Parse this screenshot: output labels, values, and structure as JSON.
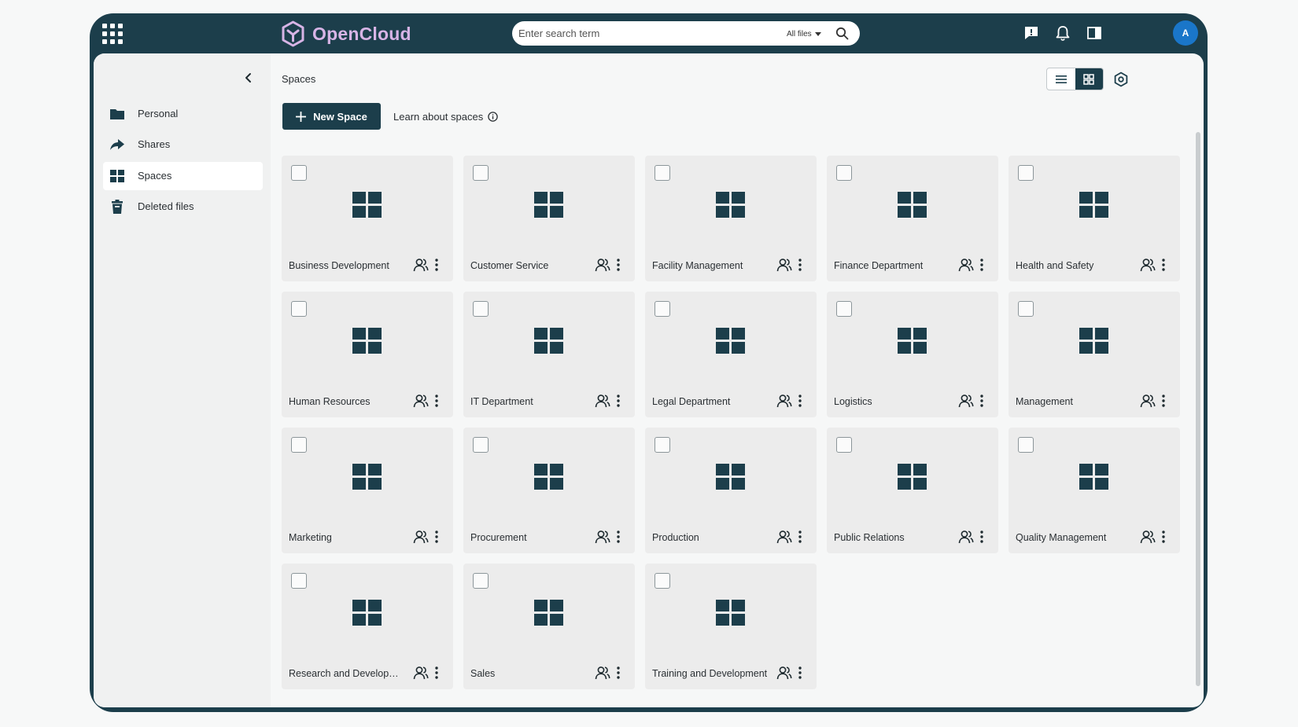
{
  "header": {
    "brand": "OpenCloud",
    "search": {
      "placeholder": "Enter search term",
      "filter_label": "All files"
    },
    "user_initial": "A",
    "colors": {
      "bar": "#1c3e4b",
      "brand_text": "#d7b4e6",
      "avatar": "#1a76c9"
    }
  },
  "sidebar": {
    "items": [
      {
        "label": "Personal",
        "icon": "folder-icon",
        "active": false
      },
      {
        "label": "Shares",
        "icon": "share-icon",
        "active": false
      },
      {
        "label": "Spaces",
        "icon": "spaces-grid-icon",
        "active": true
      },
      {
        "label": "Deleted files",
        "icon": "trash-icon",
        "active": false
      }
    ]
  },
  "main": {
    "breadcrumb": "Spaces",
    "new_space_label": "New Space",
    "learn_label": "Learn about spaces",
    "spaces": [
      {
        "name": "Business Development"
      },
      {
        "name": "Customer Service"
      },
      {
        "name": "Facility Management"
      },
      {
        "name": "Finance Department"
      },
      {
        "name": "Health and Safety"
      },
      {
        "name": "Human Resources"
      },
      {
        "name": "IT Department"
      },
      {
        "name": "Legal Department"
      },
      {
        "name": "Logistics"
      },
      {
        "name": "Management"
      },
      {
        "name": "Marketing"
      },
      {
        "name": "Procurement"
      },
      {
        "name": "Production"
      },
      {
        "name": "Public Relations"
      },
      {
        "name": "Quality Management"
      },
      {
        "name": "Research and Development"
      },
      {
        "name": "Sales"
      },
      {
        "name": "Training and Development"
      }
    ]
  }
}
